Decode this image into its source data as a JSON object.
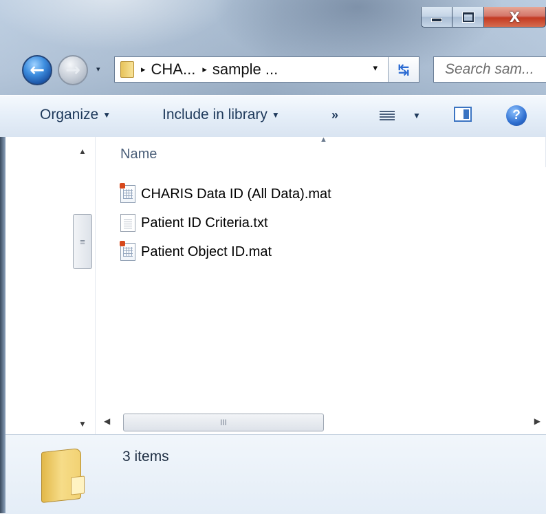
{
  "window": {
    "controls": {
      "minimize": "–",
      "maximize": "□",
      "close": "X"
    }
  },
  "nav": {
    "back_icon": "arrow-left-icon",
    "forward_icon": "arrow-right-icon",
    "history_dropdown": "▾"
  },
  "address": {
    "separator": "▸",
    "breadcrumbs": [
      "CHA...",
      "sample ..."
    ],
    "dropdown": "▾",
    "refresh_symbol": "↹"
  },
  "search": {
    "placeholder": "Search sam..."
  },
  "toolbar": {
    "organize": "Organize",
    "include_in_library": "Include in library",
    "dropdown_arrow": "▼",
    "more": "»",
    "views_dropdown": "▼",
    "help": "?"
  },
  "files": {
    "column_name": "Name",
    "sort_arrow": "▲",
    "items": [
      {
        "name": "CHARIS Data ID (All Data).mat",
        "icon": "mat-file-icon"
      },
      {
        "name": "Patient ID Criteria.txt",
        "icon": "text-file-icon"
      },
      {
        "name": "Patient Object ID.mat",
        "icon": "mat-file-icon"
      }
    ]
  },
  "scroll": {
    "up": "▲",
    "down": "▼",
    "left": "◀",
    "right": "▶",
    "grip_v": "≡",
    "grip_h": "III"
  },
  "details": {
    "item_count": "3 items"
  }
}
